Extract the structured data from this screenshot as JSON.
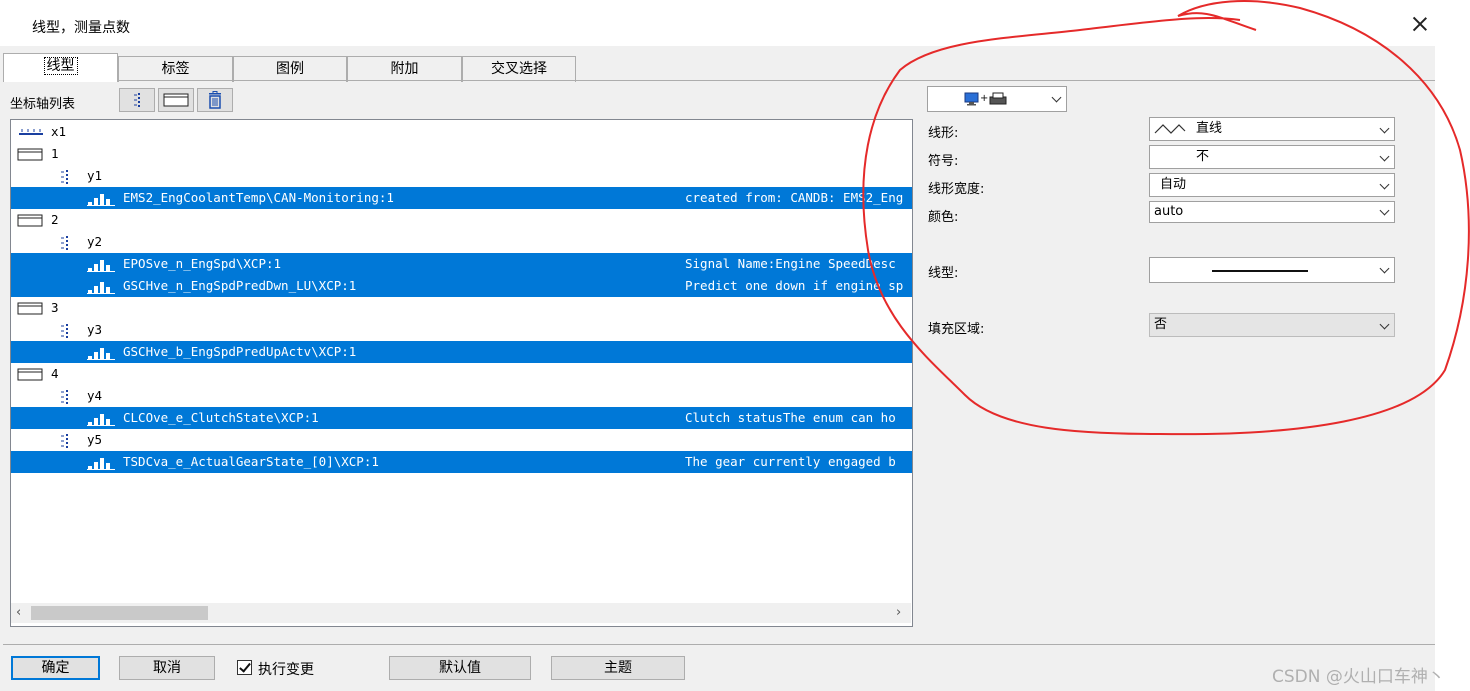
{
  "window": {
    "title": "线型，测量点数"
  },
  "tabs": [
    "线型",
    "标签",
    "图例",
    "附加",
    "交叉选择"
  ],
  "axis_list": {
    "label": "坐标轴列表"
  },
  "tree": {
    "x_axis": "x1",
    "items": [
      {
        "label": "1"
      },
      {
        "label": "y1"
      },
      {
        "label": "EMS2_EngCoolantTemp\\CAN-Monitoring:1",
        "desc": "created from: CANDB: EMS2_Eng"
      },
      {
        "label": "2"
      },
      {
        "label": "y2"
      },
      {
        "label": "EPOSve_n_EngSpd\\XCP:1",
        "desc": "Signal Name:Engine SpeedDesc"
      },
      {
        "label": "GSCHve_n_EngSpdPredDwn_LU\\XCP:1",
        "desc": "Predict one down if engine sp"
      },
      {
        "label": "3"
      },
      {
        "label": "y3"
      },
      {
        "label": "GSCHve_b_EngSpdPredUpActv\\XCP:1",
        "desc": ""
      },
      {
        "label": "4"
      },
      {
        "label": "y4"
      },
      {
        "label": "CLCOve_e_ClutchState\\XCP:1",
        "desc": "Clutch statusThe enum can ho"
      },
      {
        "label": "y5"
      },
      {
        "label": "TSDCva_e_ActualGearState_[0]\\XCP:1",
        "desc": "The gear currently engaged b"
      }
    ]
  },
  "properties": {
    "line_form": {
      "label": "线形:",
      "value": "直线"
    },
    "symbol": {
      "label": "符号:",
      "value": "不"
    },
    "line_width": {
      "label": "线形宽度:",
      "value": "自动"
    },
    "color": {
      "label": "颜色:",
      "value": "auto"
    },
    "line_style": {
      "label": "线型:"
    },
    "fill_area": {
      "label": "填充区域:",
      "value": "否"
    }
  },
  "buttons": {
    "ok": "确定",
    "cancel": "取消",
    "apply_changes": "执行变更",
    "default": "默认值",
    "theme": "主题"
  },
  "checkbox": {
    "apply_changes_checked": true
  },
  "colors": {
    "selection": "#0078d7",
    "annotation": "#e52a2a"
  },
  "watermark": "CSDN @火山口车神丶"
}
